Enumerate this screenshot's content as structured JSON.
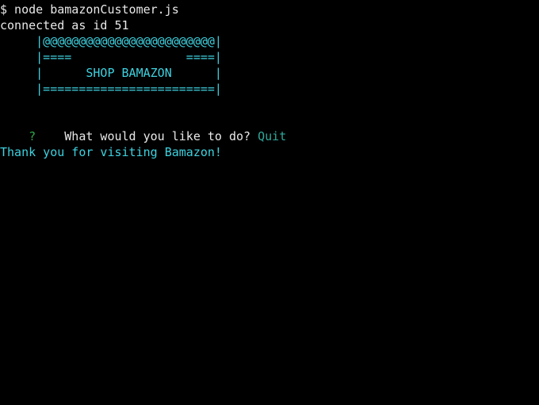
{
  "colors": {
    "background": "#000000",
    "text": "#e8e8e8",
    "cyan": "#3ed2e0",
    "answer": "#2fa89a",
    "prompt_marker": "#2fa84a"
  },
  "terminal": {
    "command_line": "$ node bamazonCustomer.js",
    "connected_line": "connected as id 51",
    "banner": {
      "line1": "     |@@@@@@@@@@@@@@@@@@@@@@@@|",
      "line2": "     |====                ====|",
      "line3": "     |      SHOP BAMAZON      |",
      "line4": "     |========================|"
    },
    "prompt": {
      "marker": "?",
      "question": "What would you like to do?",
      "answer": "Quit"
    },
    "farewell": "Thank you for visiting Bamazon!"
  }
}
